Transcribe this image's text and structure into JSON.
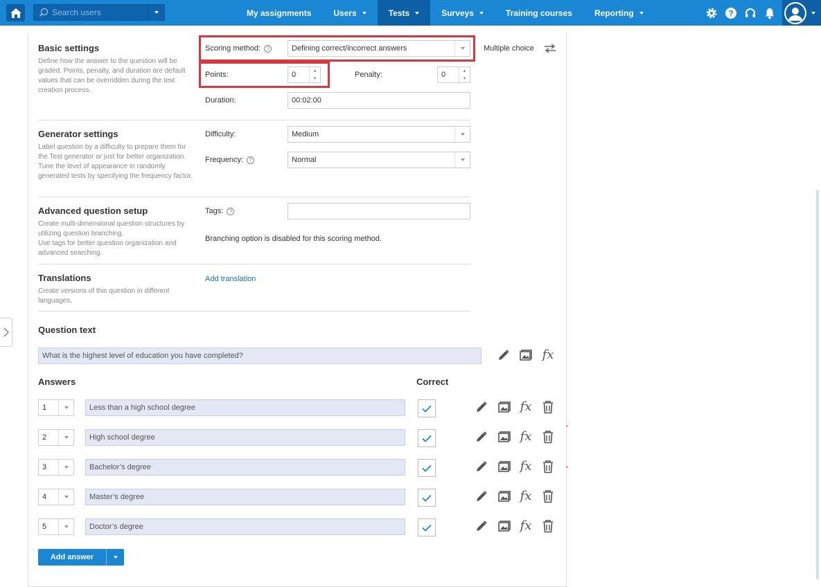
{
  "topbar": {
    "search_placeholder": "Search users",
    "nav": [
      {
        "label": "My assignments",
        "has_caret": false,
        "active": false
      },
      {
        "label": "Users",
        "has_caret": true,
        "active": false
      },
      {
        "label": "Tests",
        "has_caret": true,
        "active": true
      },
      {
        "label": "Surveys",
        "has_caret": true,
        "active": false
      },
      {
        "label": "Training courses",
        "has_caret": false,
        "active": false
      },
      {
        "label": "Reporting",
        "has_caret": true,
        "active": false
      }
    ],
    "icons": [
      "gear-icon",
      "help-icon",
      "headset-icon",
      "bell-icon",
      "user-avatar-icon"
    ]
  },
  "basic_settings": {
    "title": "Basic settings",
    "description": "Define how the answer to the question will be graded. Points, penalty, and duration are default values that can be overridden during the test creation process.",
    "scoring_method_label": "Scoring method:",
    "scoring_method_value": "Defining correct/incorrect answers",
    "question_type": "Multiple choice",
    "points_label": "Points:",
    "points_value": "0",
    "penalty_label": "Penalty:",
    "penalty_value": "0",
    "duration_label": "Duration:",
    "duration_value": "00:02:00"
  },
  "generator_settings": {
    "title": "Generator settings",
    "description": "Label question by a difficulty to prepare them for the Test generator or just for better organization. Tune the level of appearance in randomly generated tests by specifying the frequency factor.",
    "difficulty_label": "Difficulty:",
    "difficulty_value": "Medium",
    "frequency_label": "Frequency:",
    "frequency_value": "Normal"
  },
  "advanced_setup": {
    "title": "Advanced question setup",
    "description_1": "Create multi-dimensional question structures by utilizing question branching.",
    "description_2": "Use tags for better question organization and advanced searching.",
    "tags_label": "Tags:",
    "tags_value": "",
    "branching_note": "Branching option is disabled for this scoring method."
  },
  "translations": {
    "title": "Translations",
    "description": "Create versions of this question in different languages.",
    "add_link": "Add translation"
  },
  "question": {
    "title": "Question text",
    "text": "What is the highest level of education you have completed?"
  },
  "answers": {
    "title": "Answers",
    "correct_title": "Correct",
    "items": [
      {
        "num": "1",
        "text": "Less than a high school degree",
        "correct": true
      },
      {
        "num": "2",
        "text": "High school degree",
        "correct": true
      },
      {
        "num": "3",
        "text": "Bachelor’s degree",
        "correct": true
      },
      {
        "num": "4",
        "text": "Master’s degree",
        "correct": true
      },
      {
        "num": "5",
        "text": "Doctor’s degree",
        "correct": true
      }
    ],
    "add_button": "Add answer"
  },
  "colors": {
    "topbar": "#1a87d4",
    "topbar_active": "#0d5fa6",
    "highlight": "#d9363e",
    "check": "#1a87d4"
  }
}
